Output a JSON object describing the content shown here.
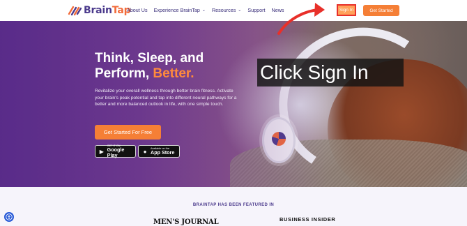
{
  "brand": {
    "name_part1": "Brain",
    "name_part2": "Tap",
    "accent": "#f26b3a",
    "primary": "#4b3a8c"
  },
  "nav": {
    "items": [
      {
        "label": "About Us",
        "has_dropdown": false
      },
      {
        "label": "Experience BrainTap",
        "has_dropdown": true
      },
      {
        "label": "Resources",
        "has_dropdown": true
      },
      {
        "label": "Support",
        "has_dropdown": false
      },
      {
        "label": "News",
        "has_dropdown": false
      }
    ],
    "signin_label": "Sign In",
    "get_started_label": "Get Started"
  },
  "hero": {
    "title_line1": "Think, Sleep, and",
    "title_line2_prefix": "Perform, ",
    "title_line2_accent": "Better.",
    "description": "Revitalize your overall wellness through better brain fitness. Activate your brain's peak potential and tap into different neural pathways for a better and more balanced outlook in life, with one simple touch.",
    "cta_label": "Get Started For Free",
    "google_play": {
      "small": "GET IT ON",
      "big": "Google Play"
    },
    "app_store": {
      "small": "Available on the",
      "big": "App Store"
    }
  },
  "annotation": {
    "callout_text": "Click Sign In",
    "arrow_color": "#e8302a"
  },
  "featured": {
    "label": "BRAINTAP HAS BEEN FEATURED IN",
    "press": [
      "MEN'S JOURNAL",
      "BUSINESS INSIDER"
    ]
  }
}
